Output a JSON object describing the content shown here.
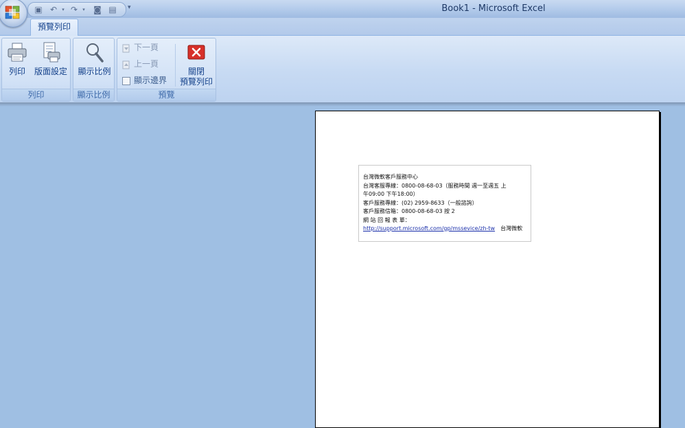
{
  "window": {
    "title": "Book1 - Microsoft Excel"
  },
  "qat": {
    "icons": [
      "save-icon",
      "undo-icon",
      "redo-icon",
      "camera-icon",
      "chart-icon"
    ]
  },
  "ribbon": {
    "tab": "預覽列印",
    "groups": {
      "print": {
        "label": "列印",
        "print_btn": "列印",
        "page_setup_btn": "版面設定"
      },
      "zoom": {
        "label": "顯示比例",
        "zoom_btn": "顯示比例"
      },
      "preview": {
        "label": "預覽",
        "next_page": "下一頁",
        "prev_page": "上一頁",
        "show_margins": "顯示邊界",
        "close_line1": "關閉",
        "close_line2": "預覽列印"
      }
    }
  },
  "page": {
    "lines": [
      "台灣微軟客戶服務中心",
      "台灣客服專線：0800-08-68-03（服務時間 週一至週五 上",
      "午09:00 下午18:00）",
      "客戶服務專線：(02) 2959-8633（一般諮詢）",
      "客戶服務信箱：0800-08-68-03 按 2",
      "網 站 回 報 表 單：",
      "http://support.microsoft.com/gp/mssevice/zh-tw"
    ],
    "link_suffix": "台灣微軟"
  }
}
